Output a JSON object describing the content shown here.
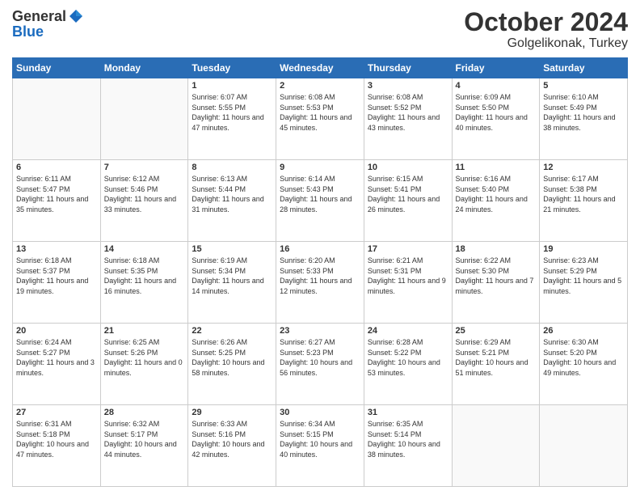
{
  "header": {
    "logo_general": "General",
    "logo_blue": "Blue",
    "month_title": "October 2024",
    "location": "Golgelikonak, Turkey"
  },
  "days_of_week": [
    "Sunday",
    "Monday",
    "Tuesday",
    "Wednesday",
    "Thursday",
    "Friday",
    "Saturday"
  ],
  "weeks": [
    [
      {
        "day": "",
        "sunrise": "",
        "sunset": "",
        "daylight": ""
      },
      {
        "day": "",
        "sunrise": "",
        "sunset": "",
        "daylight": ""
      },
      {
        "day": "1",
        "sunrise": "Sunrise: 6:07 AM",
        "sunset": "Sunset: 5:55 PM",
        "daylight": "Daylight: 11 hours and 47 minutes."
      },
      {
        "day": "2",
        "sunrise": "Sunrise: 6:08 AM",
        "sunset": "Sunset: 5:53 PM",
        "daylight": "Daylight: 11 hours and 45 minutes."
      },
      {
        "day": "3",
        "sunrise": "Sunrise: 6:08 AM",
        "sunset": "Sunset: 5:52 PM",
        "daylight": "Daylight: 11 hours and 43 minutes."
      },
      {
        "day": "4",
        "sunrise": "Sunrise: 6:09 AM",
        "sunset": "Sunset: 5:50 PM",
        "daylight": "Daylight: 11 hours and 40 minutes."
      },
      {
        "day": "5",
        "sunrise": "Sunrise: 6:10 AM",
        "sunset": "Sunset: 5:49 PM",
        "daylight": "Daylight: 11 hours and 38 minutes."
      }
    ],
    [
      {
        "day": "6",
        "sunrise": "Sunrise: 6:11 AM",
        "sunset": "Sunset: 5:47 PM",
        "daylight": "Daylight: 11 hours and 35 minutes."
      },
      {
        "day": "7",
        "sunrise": "Sunrise: 6:12 AM",
        "sunset": "Sunset: 5:46 PM",
        "daylight": "Daylight: 11 hours and 33 minutes."
      },
      {
        "day": "8",
        "sunrise": "Sunrise: 6:13 AM",
        "sunset": "Sunset: 5:44 PM",
        "daylight": "Daylight: 11 hours and 31 minutes."
      },
      {
        "day": "9",
        "sunrise": "Sunrise: 6:14 AM",
        "sunset": "Sunset: 5:43 PM",
        "daylight": "Daylight: 11 hours and 28 minutes."
      },
      {
        "day": "10",
        "sunrise": "Sunrise: 6:15 AM",
        "sunset": "Sunset: 5:41 PM",
        "daylight": "Daylight: 11 hours and 26 minutes."
      },
      {
        "day": "11",
        "sunrise": "Sunrise: 6:16 AM",
        "sunset": "Sunset: 5:40 PM",
        "daylight": "Daylight: 11 hours and 24 minutes."
      },
      {
        "day": "12",
        "sunrise": "Sunrise: 6:17 AM",
        "sunset": "Sunset: 5:38 PM",
        "daylight": "Daylight: 11 hours and 21 minutes."
      }
    ],
    [
      {
        "day": "13",
        "sunrise": "Sunrise: 6:18 AM",
        "sunset": "Sunset: 5:37 PM",
        "daylight": "Daylight: 11 hours and 19 minutes."
      },
      {
        "day": "14",
        "sunrise": "Sunrise: 6:18 AM",
        "sunset": "Sunset: 5:35 PM",
        "daylight": "Daylight: 11 hours and 16 minutes."
      },
      {
        "day": "15",
        "sunrise": "Sunrise: 6:19 AM",
        "sunset": "Sunset: 5:34 PM",
        "daylight": "Daylight: 11 hours and 14 minutes."
      },
      {
        "day": "16",
        "sunrise": "Sunrise: 6:20 AM",
        "sunset": "Sunset: 5:33 PM",
        "daylight": "Daylight: 11 hours and 12 minutes."
      },
      {
        "day": "17",
        "sunrise": "Sunrise: 6:21 AM",
        "sunset": "Sunset: 5:31 PM",
        "daylight": "Daylight: 11 hours and 9 minutes."
      },
      {
        "day": "18",
        "sunrise": "Sunrise: 6:22 AM",
        "sunset": "Sunset: 5:30 PM",
        "daylight": "Daylight: 11 hours and 7 minutes."
      },
      {
        "day": "19",
        "sunrise": "Sunrise: 6:23 AM",
        "sunset": "Sunset: 5:29 PM",
        "daylight": "Daylight: 11 hours and 5 minutes."
      }
    ],
    [
      {
        "day": "20",
        "sunrise": "Sunrise: 6:24 AM",
        "sunset": "Sunset: 5:27 PM",
        "daylight": "Daylight: 11 hours and 3 minutes."
      },
      {
        "day": "21",
        "sunrise": "Sunrise: 6:25 AM",
        "sunset": "Sunset: 5:26 PM",
        "daylight": "Daylight: 11 hours and 0 minutes."
      },
      {
        "day": "22",
        "sunrise": "Sunrise: 6:26 AM",
        "sunset": "Sunset: 5:25 PM",
        "daylight": "Daylight: 10 hours and 58 minutes."
      },
      {
        "day": "23",
        "sunrise": "Sunrise: 6:27 AM",
        "sunset": "Sunset: 5:23 PM",
        "daylight": "Daylight: 10 hours and 56 minutes."
      },
      {
        "day": "24",
        "sunrise": "Sunrise: 6:28 AM",
        "sunset": "Sunset: 5:22 PM",
        "daylight": "Daylight: 10 hours and 53 minutes."
      },
      {
        "day": "25",
        "sunrise": "Sunrise: 6:29 AM",
        "sunset": "Sunset: 5:21 PM",
        "daylight": "Daylight: 10 hours and 51 minutes."
      },
      {
        "day": "26",
        "sunrise": "Sunrise: 6:30 AM",
        "sunset": "Sunset: 5:20 PM",
        "daylight": "Daylight: 10 hours and 49 minutes."
      }
    ],
    [
      {
        "day": "27",
        "sunrise": "Sunrise: 6:31 AM",
        "sunset": "Sunset: 5:18 PM",
        "daylight": "Daylight: 10 hours and 47 minutes."
      },
      {
        "day": "28",
        "sunrise": "Sunrise: 6:32 AM",
        "sunset": "Sunset: 5:17 PM",
        "daylight": "Daylight: 10 hours and 44 minutes."
      },
      {
        "day": "29",
        "sunrise": "Sunrise: 6:33 AM",
        "sunset": "Sunset: 5:16 PM",
        "daylight": "Daylight: 10 hours and 42 minutes."
      },
      {
        "day": "30",
        "sunrise": "Sunrise: 6:34 AM",
        "sunset": "Sunset: 5:15 PM",
        "daylight": "Daylight: 10 hours and 40 minutes."
      },
      {
        "day": "31",
        "sunrise": "Sunrise: 6:35 AM",
        "sunset": "Sunset: 5:14 PM",
        "daylight": "Daylight: 10 hours and 38 minutes."
      },
      {
        "day": "",
        "sunrise": "",
        "sunset": "",
        "daylight": ""
      },
      {
        "day": "",
        "sunrise": "",
        "sunset": "",
        "daylight": ""
      }
    ]
  ]
}
